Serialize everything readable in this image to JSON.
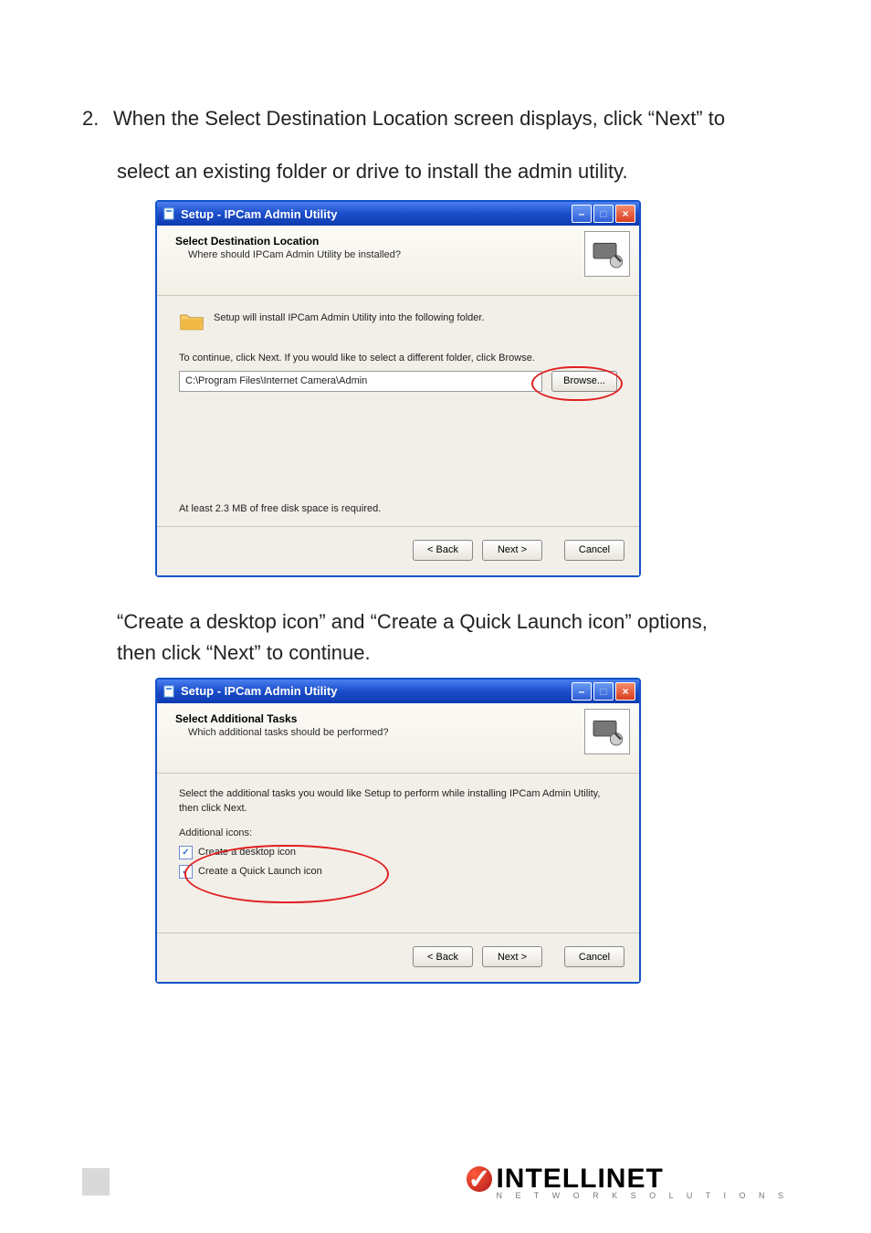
{
  "doc": {
    "step_num": "2.",
    "step_text_line1": "When the Select Destination Location screen displays, click “Next” to",
    "step_text_line2": "select an existing folder or drive to install the admin utility.",
    "mid_note_line1": "“Create a desktop icon” and “Create a Quick Launch icon” options,",
    "mid_note_line2": "then click “Next” to continue."
  },
  "wiz1": {
    "title": "Setup - IPCam Admin Utility",
    "head": "Select Destination Location",
    "sub": "Where should IPCam Admin Utility be installed?",
    "introl": "Setup will install IPCam Admin Utility into the following folder.",
    "cont": "To continue, click Next. If you would like to select a different folder, click Browse.",
    "path": "C:\\Program Files\\Internet Camera\\Admin",
    "browse": "Browse...",
    "space": "At least 2.3 MB of free disk space is required.",
    "back": "< Back",
    "next": "Next >",
    "cancel": "Cancel"
  },
  "wiz2": {
    "title": "Setup - IPCam Admin Utility",
    "head": "Select Additional Tasks",
    "sub": "Which additional tasks should be performed?",
    "lead": "Select the additional tasks you would like Setup to perform while installing IPCam Admin Utility, then click Next.",
    "group": "Additional icons:",
    "cb1": "Create a desktop icon",
    "cb2": "Create a Quick Launch icon",
    "back": "< Back",
    "next": "Next >",
    "cancel": "Cancel"
  },
  "brand": {
    "name": "INTELLINET",
    "sub": "N E T W O R K   S O L U T I O N S"
  }
}
